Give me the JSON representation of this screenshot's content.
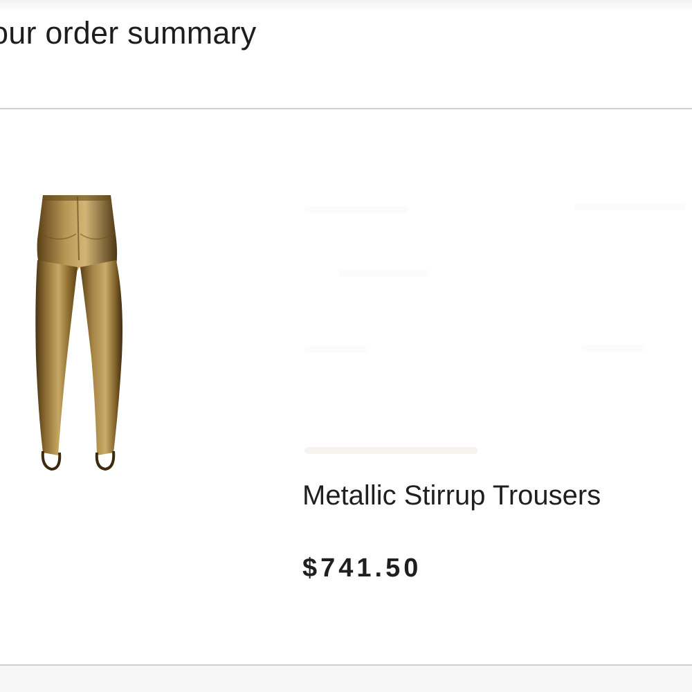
{
  "order_summary": {
    "title": "our order summary"
  },
  "item": {
    "name": "Metallic Stirrup Trousers",
    "price": "$741.50",
    "image_icon": "metallic-trousers-image",
    "image_color": "#9a7a3c"
  }
}
